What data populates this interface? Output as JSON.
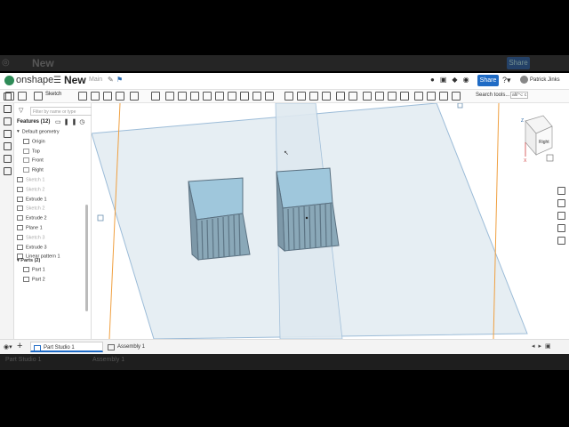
{
  "header": {
    "logo": "onshape",
    "doc_title": "New",
    "branch": "Main",
    "share_label": "Share",
    "user_name": "Patrick Jinks"
  },
  "toolbar": {
    "sketch_label": "Sketch",
    "search_label": "Search tools...",
    "search_shortcut": "alt/⌥ c"
  },
  "feature_panel": {
    "filter_placeholder": "Filter by name or type",
    "features_header": "Features (12)",
    "items": [
      {
        "label": "Default geometry",
        "muted": false
      },
      {
        "label": "Origin",
        "muted": false
      },
      {
        "label": "Top",
        "muted": false
      },
      {
        "label": "Front",
        "muted": false
      },
      {
        "label": "Right",
        "muted": false
      },
      {
        "label": "Sketch 1",
        "muted": true
      },
      {
        "label": "Sketch 2",
        "muted": true
      },
      {
        "label": "Extrude 1",
        "muted": false
      },
      {
        "label": "Sketch 2",
        "muted": true
      },
      {
        "label": "Extrude 2",
        "muted": false
      },
      {
        "label": "Plane 1",
        "muted": false
      },
      {
        "label": "Sketch 3",
        "muted": true
      },
      {
        "label": "Extrude 3",
        "muted": false
      },
      {
        "label": "Linear pattern 1",
        "muted": false
      }
    ],
    "parts_header": "Parts (2)",
    "parts": [
      "Part 1",
      "Part 2"
    ]
  },
  "view_cube": {
    "face_label": "Right",
    "axis_z": "Z",
    "axis_x": "X"
  },
  "tabs": [
    {
      "label": "Part Studio 1",
      "active": true
    },
    {
      "label": "Assembly 1",
      "active": false
    }
  ],
  "background_window": {
    "title": "New",
    "share_label": "Share",
    "tabs": [
      "Part Studio 1",
      "Assembly 1"
    ]
  },
  "colors": {
    "accent": "#1f6bc5",
    "plane_fill": "#e6eef3",
    "plane_edge": "#9cbcd8",
    "part_fill": "#8fb3c7",
    "axis_orange": "#f0a040"
  }
}
